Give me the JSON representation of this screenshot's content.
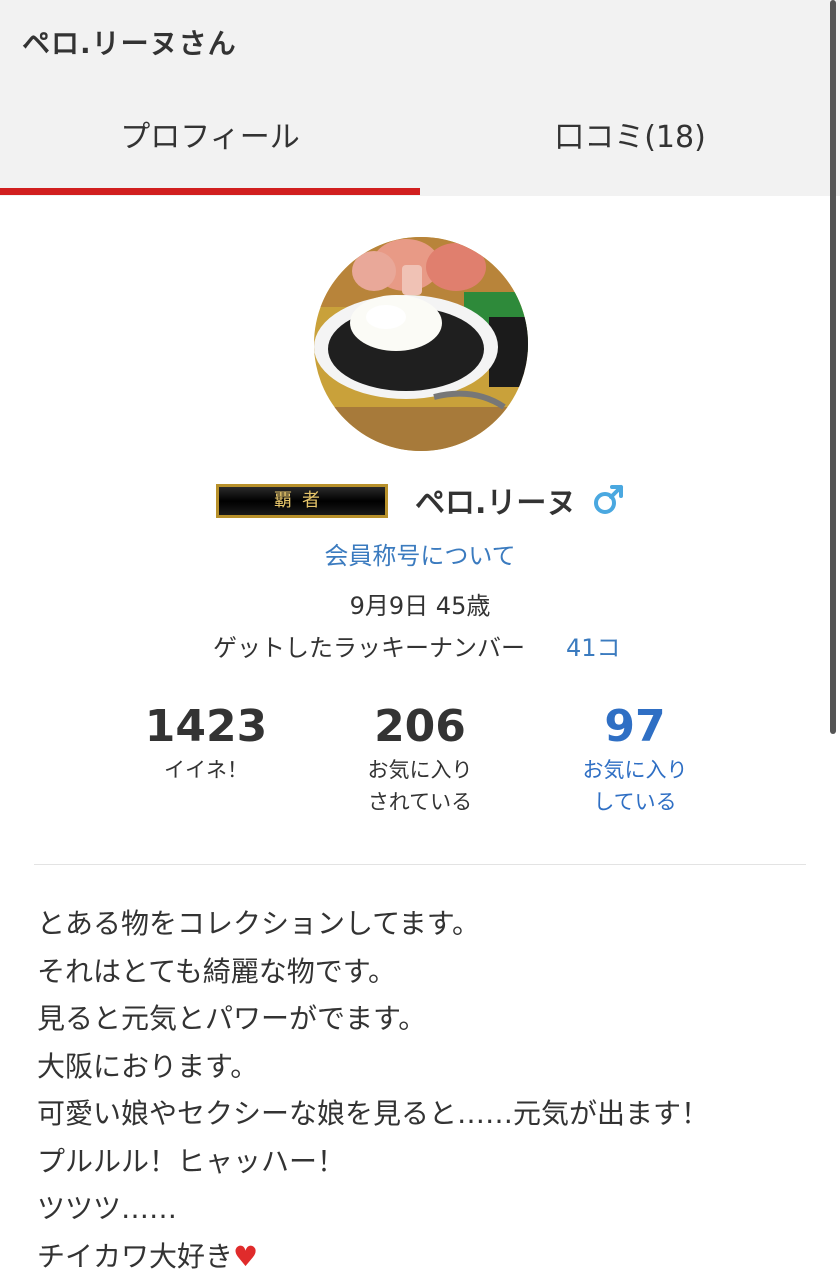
{
  "header": {
    "title": "ペロ.リーヌさん",
    "tabs": [
      {
        "label": "プロフィール",
        "active": true
      },
      {
        "label": "口コミ(18)",
        "active": false
      }
    ],
    "accent_color": "#d11f1f"
  },
  "profile": {
    "avatar_icon": "curry-photo-avatar",
    "rank_badge": "覇者",
    "name": "ペロ.リーヌ",
    "gender_icon": "male-icon",
    "title_link": "会員称号について",
    "birthday_age": "9月9日 45歳",
    "lucky_label": "ゲットしたラッキーナンバー",
    "lucky_count": "41コ",
    "link_color": "#3b7bbf"
  },
  "stats": [
    {
      "value": "1423",
      "label": "イイネ！"
    },
    {
      "value": "206",
      "label": "お気に入り\nされている"
    },
    {
      "value": "97",
      "label": "お気に入り\nしている"
    }
  ],
  "bio": {
    "lines": [
      "とある物をコレクションしてます。",
      "それはとても綺麗な物です。",
      "見ると元気とパワーがでます。",
      "大阪におります。",
      "可愛い娘やセクシーな娘を見ると……元気が出ます！",
      "プルルル！ヒャッハー！",
      "ツツツ……",
      "チイカワ大好き"
    ],
    "last_line_icon": "heart-emoji"
  }
}
